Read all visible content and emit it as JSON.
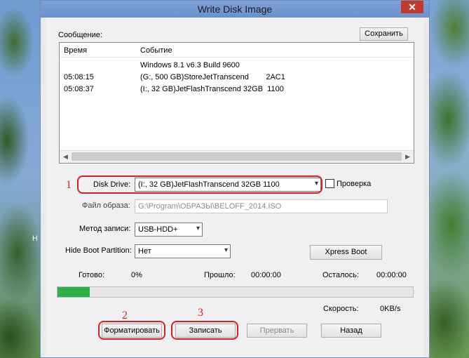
{
  "window": {
    "title": "Write Disk Image",
    "close_glyph": "✕"
  },
  "desktop": {
    "letter": "H"
  },
  "log": {
    "label": "Сообщение:",
    "save_button": "Сохранить",
    "columns": [
      "Время",
      "Событие"
    ],
    "rows": [
      {
        "time": "",
        "event": "Windows 8.1 v6.3 Build 9600"
      },
      {
        "time": "05:08:15",
        "event": "(G:, 500 GB)StoreJetTranscend        2AC1"
      },
      {
        "time": "05:08:37",
        "event": "(I:, 32 GB)JetFlashTranscend 32GB  1100"
      }
    ],
    "scroll_left": "◀",
    "scroll_right": "▶"
  },
  "form": {
    "disk_drive_label": "Disk Drive:",
    "disk_drive_value": "(I:, 32 GB)JetFlashTranscend 32GB  1100",
    "verify_label": "Проверка",
    "verify_checked": false,
    "image_file_label": "Файл образа:",
    "image_file_value": "G:\\Program\\ОБРАЗЫ\\BELOFF_2014.ISO",
    "write_method_label": "Метод записи:",
    "write_method_value": "USB-HDD+",
    "hide_boot_label": "Hide Boot Partition:",
    "hide_boot_value": "Нет",
    "xpress_boot_button": "Xpress Boot",
    "dropdown_glyph": "▾"
  },
  "status": {
    "ready_label": "Готово:",
    "ready_value": "0%",
    "elapsed_label": "Прошло:",
    "elapsed_value": "00:00:00",
    "remaining_label": "Осталось:",
    "remaining_value": "00:00:00",
    "speed_label": "Скорость:",
    "speed_value": "0KB/s",
    "progress_fraction": 0.09,
    "progress_color": "#2db24a"
  },
  "buttons": {
    "format": "Форматировать",
    "write": "Записать",
    "abort": "Прервать",
    "back": "Назад"
  },
  "annotations": {
    "one": "1",
    "two": "2",
    "three": "3",
    "color": "#d81f26"
  }
}
